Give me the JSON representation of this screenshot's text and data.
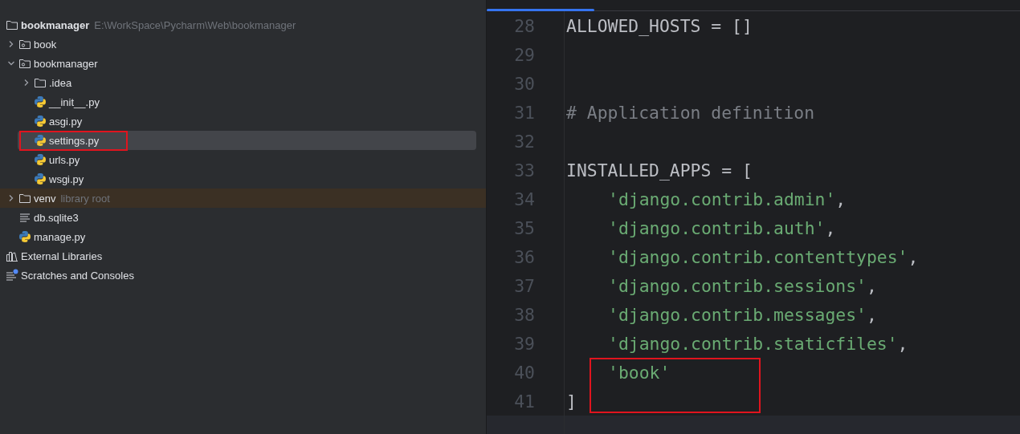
{
  "project_tree": {
    "items": [
      {
        "label": "bookmanager",
        "kind": "project",
        "hint": "E:\\WorkSpace\\Pycharm\\Web\\bookmanager",
        "children": [
          {
            "label": "book",
            "kind": "package",
            "expanded": false,
            "selected": false
          },
          {
            "label": "bookmanager",
            "kind": "package",
            "expanded": true,
            "selected": false,
            "children": [
              {
                "label": ".idea",
                "kind": "folder",
                "expanded": false,
                "selected": false
              },
              {
                "label": "__init__.py",
                "kind": "python",
                "selected": false,
                "annotated": false
              },
              {
                "label": "asgi.py",
                "kind": "python",
                "selected": false,
                "annotated": false
              },
              {
                "label": "settings.py",
                "kind": "python",
                "selected": true,
                "annotated": true
              },
              {
                "label": "urls.py",
                "kind": "python",
                "selected": false,
                "annotated": false
              },
              {
                "label": "wsgi.py",
                "kind": "python",
                "selected": false,
                "annotated": false
              }
            ]
          },
          {
            "label": "venv",
            "kind": "library-folder",
            "hint": "library root",
            "expanded": false,
            "selected": false
          },
          {
            "label": "db.sqlite3",
            "kind": "text",
            "selected": false
          },
          {
            "label": "manage.py",
            "kind": "python",
            "selected": false,
            "annotated": false
          }
        ]
      },
      {
        "label": "External Libraries",
        "kind": "libraries"
      },
      {
        "label": "Scratches and Consoles",
        "kind": "scratches"
      }
    ]
  },
  "editor": {
    "lines": [
      {
        "number": "28",
        "tokens": [
          {
            "text": "ALLOWED_HOSTS = []",
            "kind": "plain"
          }
        ]
      },
      {
        "number": "29"
      },
      {
        "number": "30"
      },
      {
        "number": "31",
        "tokens": [
          {
            "text": "# Application definition",
            "kind": "comment"
          }
        ]
      },
      {
        "number": "32"
      },
      {
        "number": "33",
        "tokens": [
          {
            "text": "INSTALLED_APPS = [",
            "kind": "plain"
          }
        ]
      },
      {
        "number": "34",
        "indented": true,
        "tokens": [
          {
            "text": "'django.contrib.admin'",
            "kind": "string"
          },
          {
            "text": ",",
            "kind": "plain"
          }
        ]
      },
      {
        "number": "35",
        "indented": true,
        "tokens": [
          {
            "text": "'django.contrib.auth'",
            "kind": "string"
          },
          {
            "text": ",",
            "kind": "plain"
          }
        ]
      },
      {
        "number": "36",
        "indented": true,
        "tokens": [
          {
            "text": "'django.contrib.contenttypes'",
            "kind": "string"
          },
          {
            "text": ",",
            "kind": "plain"
          }
        ]
      },
      {
        "number": "37",
        "indented": true,
        "tokens": [
          {
            "text": "'django.contrib.sessions'",
            "kind": "string"
          },
          {
            "text": ",",
            "kind": "plain"
          }
        ]
      },
      {
        "number": "38",
        "indented": true,
        "tokens": [
          {
            "text": "'django.contrib.messages'",
            "kind": "string"
          },
          {
            "text": ",",
            "kind": "plain"
          }
        ]
      },
      {
        "number": "39",
        "indented": true,
        "tokens": [
          {
            "text": "'django.contrib.staticfiles'",
            "kind": "string"
          },
          {
            "text": ",",
            "kind": "plain"
          }
        ]
      },
      {
        "number": "40",
        "indented": true,
        "annotated": true,
        "tokens": [
          {
            "text": "'book'",
            "kind": "string"
          }
        ]
      },
      {
        "number": "41",
        "tokens": [
          {
            "text": "]",
            "kind": "plain"
          }
        ]
      },
      {
        "current": true
      }
    ]
  }
}
